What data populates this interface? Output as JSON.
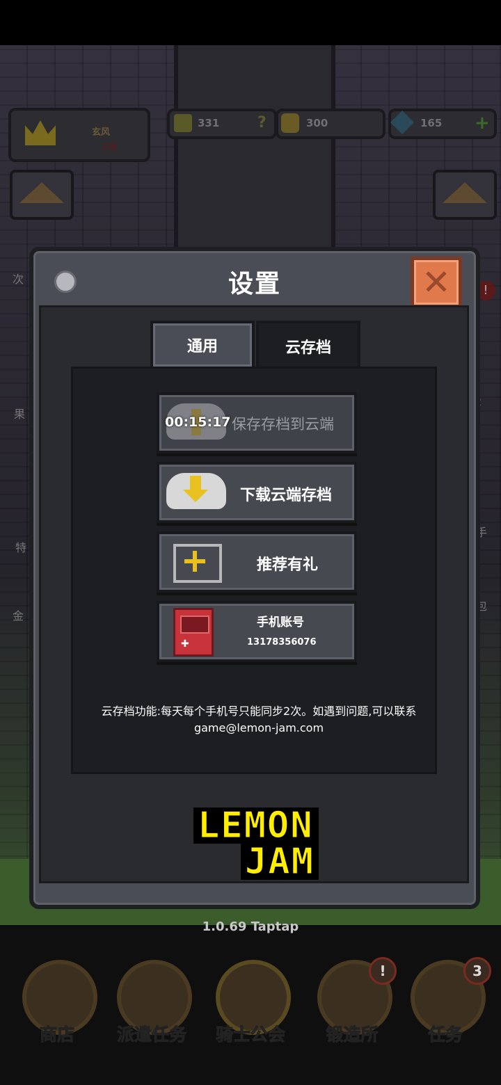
{
  "hud": {
    "player_name": "玄风",
    "player_sub": "三世",
    "trophy_count": "331",
    "help_glyph": "?",
    "gold_count": "300",
    "gem_count": "165",
    "add_glyph": "+"
  },
  "side_labels": {
    "left": [
      "次",
      "果",
      "特",
      "金"
    ],
    "right": [
      "!",
      "2",
      "手",
      "包"
    ]
  },
  "modal": {
    "title": "设置",
    "close_glyph": "✕",
    "tabs": [
      {
        "label": "通用",
        "active": false
      },
      {
        "label": "云存档",
        "active": true
      }
    ],
    "buttons": [
      {
        "name": "save-to-cloud",
        "timer": "00:15:17",
        "label": "保存存档到云端",
        "disabled": true,
        "icon": "cloud-upload-icon"
      },
      {
        "name": "download-cloud",
        "label": "下载云端存档",
        "disabled": false,
        "icon": "cloud-download-icon"
      },
      {
        "name": "referral-gift",
        "label": "推荐有礼",
        "disabled": false,
        "icon": "gift-icon"
      },
      {
        "name": "phone-account",
        "label": "手机账号",
        "phone": "13178356076",
        "disabled": false,
        "icon": "phone-console-icon"
      }
    ],
    "note": "云存档功能:每天每个手机号只能同步2次。如遇到问题,可以联系 game@lemon-jam.com",
    "logo_line1": "LEMON",
    "logo_line2": "JAM"
  },
  "version": "1.0.69 Taptap",
  "nav": [
    {
      "label": "商店",
      "icon": "shop-icon"
    },
    {
      "label": "派遣任务",
      "icon": "lock-icon"
    },
    {
      "label": "骑士公会",
      "icon": "knight-helmet-icon"
    },
    {
      "label": "锻造所",
      "icon": "lock-icon",
      "badge": "!"
    },
    {
      "label": "任务",
      "icon": "scroll-icon",
      "badge": "3"
    }
  ],
  "colors": {
    "panel": "#4a4d55",
    "close_button": "#e0794c",
    "logo_yellow": "#ffee00"
  }
}
